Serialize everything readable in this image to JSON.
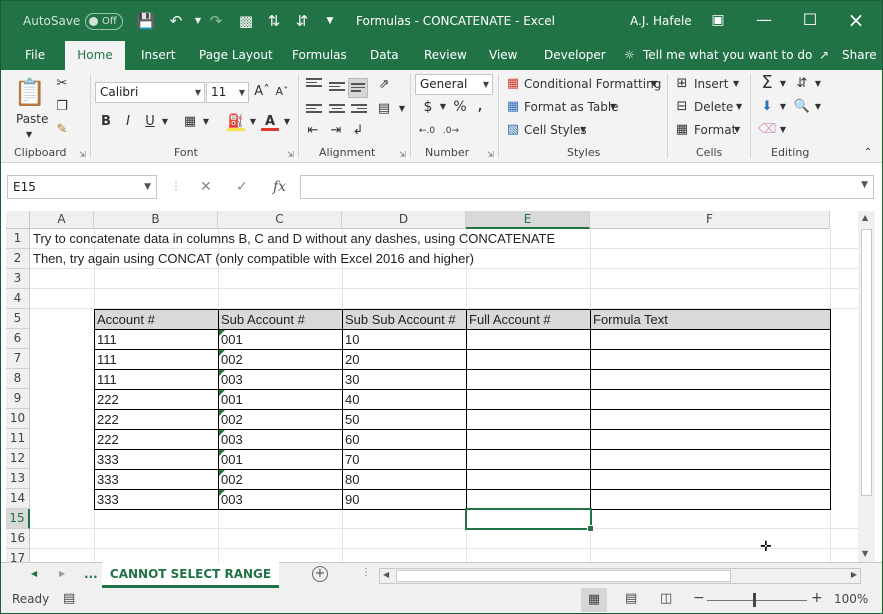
{
  "titlebar": {
    "autosave_label": "AutoSave",
    "autosave_state": "Off",
    "title": "Formulas - CONCATENATE  -  Excel",
    "user": "A.J. Hafele"
  },
  "tabs": [
    {
      "label": "File"
    },
    {
      "label": "Home"
    },
    {
      "label": "Insert"
    },
    {
      "label": "Page Layout"
    },
    {
      "label": "Formulas"
    },
    {
      "label": "Data"
    },
    {
      "label": "Review"
    },
    {
      "label": "View"
    },
    {
      "label": "Developer"
    }
  ],
  "tell_me": "Tell me what you want to do",
  "share": "Share",
  "ribbon": {
    "paste": "Paste",
    "font_name": "Calibri",
    "font_size": "11",
    "bold": "B",
    "italic": "I",
    "underline": "U",
    "number_format": "General",
    "currency": "$",
    "percent": "%",
    "comma": ",",
    "conditional_formatting": "Conditional Formatting",
    "format_as_table": "Format as Table",
    "cell_styles": "Cell Styles",
    "insert": "Insert",
    "delete": "Delete",
    "format": "Format",
    "groups": [
      "Clipboard",
      "Font",
      "Alignment",
      "Number",
      "Styles",
      "Cells",
      "Editing"
    ]
  },
  "formula_bar": {
    "name_box": "E15",
    "fx": "fx",
    "value": ""
  },
  "columns": [
    "A",
    "B",
    "C",
    "D",
    "E",
    "F"
  ],
  "rows": [
    "1",
    "2",
    "3",
    "4",
    "5",
    "6",
    "7",
    "8",
    "9",
    "10",
    "11",
    "12",
    "13",
    "14",
    "15",
    "16",
    "17"
  ],
  "notes": {
    "row1": "Try to concatenate data in columns B, C and D without any dashes, using CONCATENATE",
    "row2": "Then, try again using CONCAT (only compatible with Excel 2016 and higher)"
  },
  "table": {
    "headers": [
      "Account #",
      "Sub Account #",
      "Sub Sub Account #",
      "Full Account #",
      "Formula Text"
    ],
    "rows": [
      [
        "111",
        "001",
        "10",
        "",
        ""
      ],
      [
        "111",
        "002",
        "20",
        "",
        ""
      ],
      [
        "111",
        "003",
        "30",
        "",
        ""
      ],
      [
        "222",
        "001",
        "40",
        "",
        ""
      ],
      [
        "222",
        "002",
        "50",
        "",
        ""
      ],
      [
        "222",
        "003",
        "60",
        "",
        ""
      ],
      [
        "333",
        "001",
        "70",
        "",
        ""
      ],
      [
        "333",
        "002",
        "80",
        "",
        ""
      ],
      [
        "333",
        "003",
        "90",
        "",
        ""
      ]
    ]
  },
  "sheet": {
    "ellipsis": "...",
    "active_tab": "CANNOT SELECT RANGE"
  },
  "status": {
    "ready": "Ready",
    "zoom": "100%"
  },
  "colors": {
    "excel_green": "#217346",
    "header_fill": "#d9d9d9"
  }
}
